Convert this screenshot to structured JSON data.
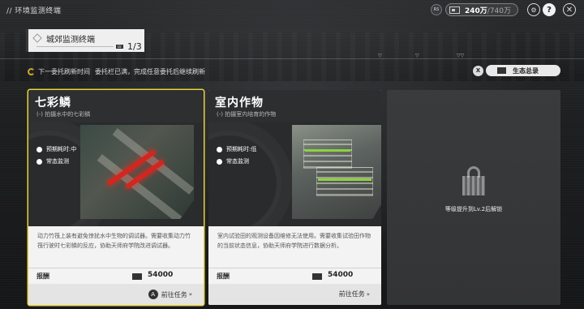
{
  "topbar": {
    "breadcrumb": "// 环境监测终端",
    "rs_badge": "RS",
    "funds_amount": "240万",
    "funds_max": "/740万"
  },
  "terminal_tab": {
    "name": "城郊监测终端",
    "level_tag": "LV.",
    "count": "1/3"
  },
  "notice": {
    "refresh_label": "下一委托刷新时间",
    "full_message": "委托栏已满，完成任意委托后继续刷新"
  },
  "eco_button": {
    "key": "X",
    "label": "生态总录"
  },
  "cards": [
    {
      "title": "七彩鳞",
      "subtitle": "(-) 拍摄水中的七彩鳞",
      "time_label": "预期耗时:中",
      "type_label": "常态监测",
      "description": "动力竹筏上装有避免惊扰水中生物的调试器。需要收集动力竹筏行驶时七彩鳞的反应，协助天师府学院改进调试器。",
      "reward_label": "报酬",
      "reward_value": "54000",
      "go_key": "A",
      "go_label": "前往任务",
      "go_chevron": "»"
    },
    {
      "title": "室内作物",
      "subtitle": "(-) 拍摄室内培育的作物",
      "time_label": "预期耗时:低",
      "type_label": "常态监测",
      "description": "室内试验田的观测设备因维修无法使用。需要收集试验田作物的当前状态信息，协助天师府学院进行数据分析。",
      "reward_label": "报酬",
      "reward_value": "54000",
      "go_label": "前往任务",
      "go_chevron": "»"
    }
  ],
  "locked_card": {
    "message": "等级提升到Lv.2后解锁"
  },
  "colors": {
    "accent_yellow": "#e8d33a",
    "fish_red": "#d2261f",
    "card_bg": "#f3f3f3"
  }
}
